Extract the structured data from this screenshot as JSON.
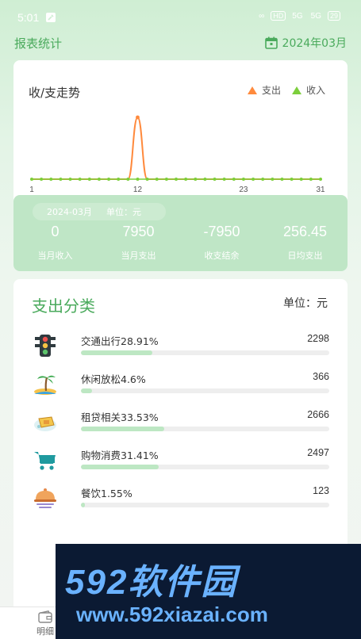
{
  "status_bar": {
    "time": "5:01",
    "network_badge": "HD",
    "signal_1": "5G",
    "signal_2": "5G",
    "battery": "29"
  },
  "header": {
    "title": "报表统计",
    "date": "2024年03月"
  },
  "trend": {
    "title": "收/支走势",
    "legend": [
      {
        "label": "支出",
        "color": "#ff8a3d"
      },
      {
        "label": "收入",
        "color": "#7ccf3c"
      }
    ]
  },
  "chart_data": {
    "type": "line",
    "x_ticks": [
      "1",
      "12",
      "23",
      "31"
    ],
    "x": [
      1,
      2,
      3,
      4,
      5,
      6,
      7,
      8,
      9,
      10,
      11,
      12,
      13,
      14,
      15,
      16,
      17,
      18,
      19,
      20,
      21,
      22,
      23,
      24,
      25,
      26,
      27,
      28,
      29,
      30,
      31
    ],
    "series": [
      {
        "name": "支出",
        "color": "#ff8a3d",
        "values": [
          0,
          0,
          0,
          0,
          0,
          0,
          0,
          0,
          0,
          0,
          0,
          7950,
          0,
          0,
          0,
          0,
          0,
          0,
          0,
          0,
          0,
          0,
          0,
          0,
          0,
          0,
          0,
          0,
          0,
          0,
          0
        ]
      },
      {
        "name": "收入",
        "color": "#7ccf3c",
        "values": [
          0,
          0,
          0,
          0,
          0,
          0,
          0,
          0,
          0,
          0,
          0,
          0,
          0,
          0,
          0,
          0,
          0,
          0,
          0,
          0,
          0,
          0,
          0,
          0,
          0,
          0,
          0,
          0,
          0,
          0,
          0
        ]
      }
    ]
  },
  "summary": {
    "month": "2024-03月",
    "unit": "单位：元",
    "stats": [
      {
        "value": "0",
        "label": "当月收入"
      },
      {
        "value": "7950",
        "label": "当月支出"
      },
      {
        "value": "-7950",
        "label": "收支结余"
      },
      {
        "value": "256.45",
        "label": "日均支出"
      }
    ]
  },
  "categories": {
    "title": "支出分类",
    "unit": "单位：元",
    "items": [
      {
        "name": "交通出行28.91%",
        "amount": "2298",
        "percent": 28.91,
        "icon": "traffic-light-icon"
      },
      {
        "name": "休闲放松4.6%",
        "amount": "366",
        "percent": 4.6,
        "icon": "palm-beach-icon"
      },
      {
        "name": "租贷相关33.53%",
        "amount": "2666",
        "percent": 33.53,
        "icon": "rent-icon"
      },
      {
        "name": "购物消费31.41%",
        "amount": "2497",
        "percent": 31.41,
        "icon": "shopping-cart-icon"
      },
      {
        "name": "餐饮1.55%",
        "amount": "123",
        "percent": 1.55,
        "icon": "food-cloche-icon"
      }
    ]
  },
  "bottom_nav": {
    "items": [
      {
        "label": "明细",
        "icon": "wallet-icon"
      }
    ]
  },
  "watermark": {
    "line1": "592软件园",
    "line2": "www.592xiazai.com"
  }
}
